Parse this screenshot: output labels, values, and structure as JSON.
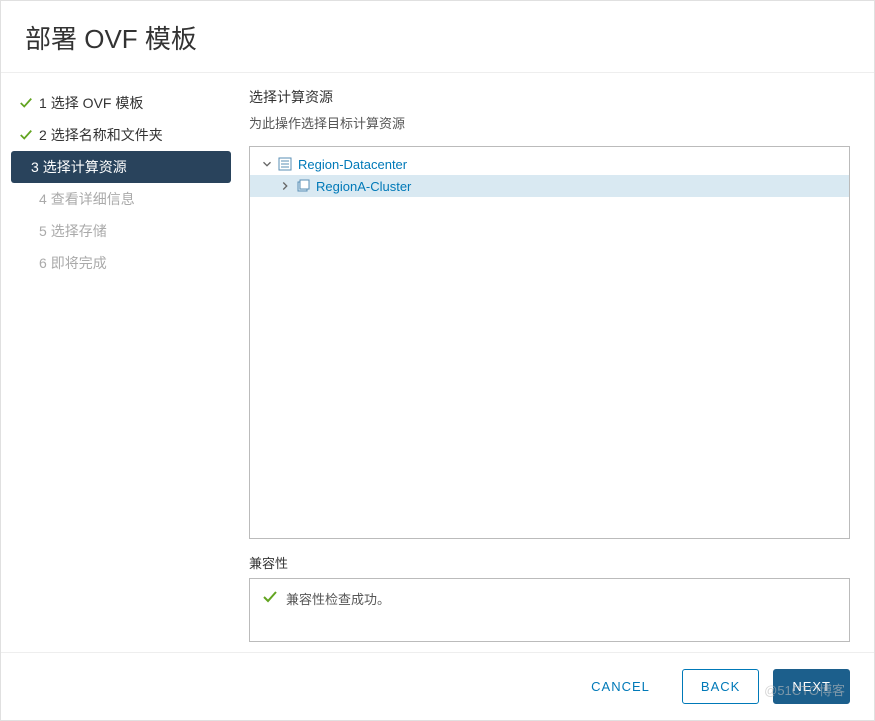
{
  "dialog": {
    "title": "部署 OVF 模板"
  },
  "sidebar": {
    "steps": [
      {
        "num": "1",
        "label": "选择 OVF 模板",
        "state": "completed"
      },
      {
        "num": "2",
        "label": "选择名称和文件夹",
        "state": "completed"
      },
      {
        "num": "3",
        "label": "选择计算资源",
        "state": "active"
      },
      {
        "num": "4",
        "label": "查看详细信息",
        "state": "pending"
      },
      {
        "num": "5",
        "label": "选择存储",
        "state": "pending"
      },
      {
        "num": "6",
        "label": "即将完成",
        "state": "pending"
      }
    ]
  },
  "content": {
    "title": "选择计算资源",
    "subtitle": "为此操作选择目标计算资源"
  },
  "tree": {
    "items": [
      {
        "label": "Region-Datacenter",
        "icon": "datacenter",
        "expanded": true,
        "level": 1,
        "selected": false
      },
      {
        "label": "RegionA-Cluster",
        "icon": "cluster",
        "expanded": false,
        "level": 2,
        "selected": true
      }
    ]
  },
  "compatibility": {
    "title": "兼容性",
    "message": "兼容性检查成功。"
  },
  "footer": {
    "cancel": "CANCEL",
    "back": "BACK",
    "next": "NEXT"
  },
  "watermark": "@51CTO博客"
}
